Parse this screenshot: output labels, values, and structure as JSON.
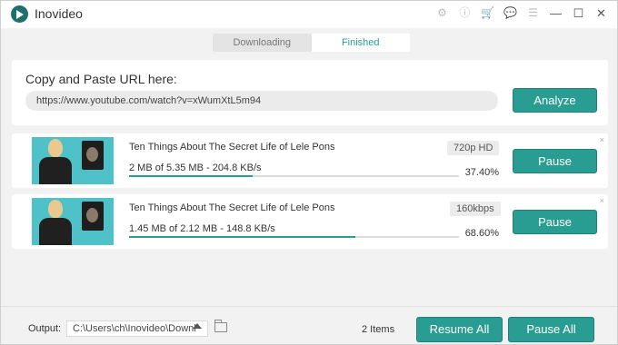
{
  "app": {
    "title": "Inovideo"
  },
  "titlebar_icons": [
    {
      "name": "settings-icon",
      "glyph": "⚙"
    },
    {
      "name": "info-icon",
      "glyph": "ⓘ"
    },
    {
      "name": "cart-icon",
      "glyph": "🛒"
    },
    {
      "name": "chat-icon",
      "glyph": "💬"
    },
    {
      "name": "menu-icon",
      "glyph": "☰"
    },
    {
      "name": "minimize-icon",
      "glyph": "—"
    },
    {
      "name": "maximize-icon",
      "glyph": "☐"
    },
    {
      "name": "close-icon",
      "glyph": "✕"
    }
  ],
  "tabs": [
    {
      "label": "Downloading",
      "active": false
    },
    {
      "label": "Finished",
      "active": true
    }
  ],
  "url_section": {
    "title": "Copy and Paste URL here:",
    "url_value": "https://www.youtube.com/watch?v=xWumXtL5m94",
    "analyze_label": "Analyze"
  },
  "downloads": [
    {
      "title": "Ten Things About The Secret Life of Lele Pons",
      "quality": "720p HD",
      "progress_text": "2 MB of 5.35 MB - 204.8 KB/s",
      "percent_label": "37.40%",
      "progress": 0.374,
      "button_label": "Pause",
      "close": "×"
    },
    {
      "title": "Ten Things About The Secret Life of Lele Pons",
      "quality": "160kbps",
      "progress_text": "1.45 MB of 2.12 MB - 148.8 KB/s",
      "percent_label": "68.60%",
      "progress": 0.686,
      "button_label": "Pause",
      "close": "×"
    }
  ],
  "footer": {
    "output_label": "Output:",
    "output_path": "C:\\Users\\ch\\Inovideo\\Downl",
    "items_count": "2 Items",
    "resume_all_label": "Resume All",
    "pause_all_label": "Pause All"
  },
  "colors": {
    "accent": "#2a9d93",
    "background": "#f2f2f2"
  }
}
